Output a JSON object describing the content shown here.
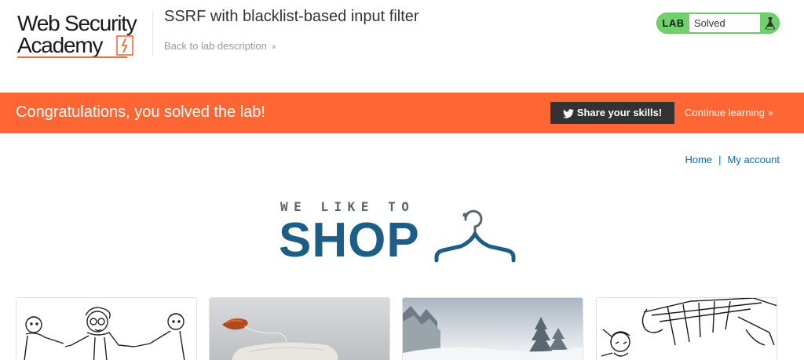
{
  "header": {
    "logo_line1": "Web Security",
    "logo_line2": "Academy",
    "lab_title": "SSRF with blacklist-based input filter",
    "back_link": "Back to lab description",
    "lab_badge": "LAB",
    "status": "Solved"
  },
  "banner": {
    "message": "Congratulations, you solved the lab!",
    "share_label": "Share your skills!",
    "continue_label": "Continue learning"
  },
  "nav": {
    "home": "Home",
    "separator": "|",
    "my_account": "My account"
  },
  "hero": {
    "tagline": "WE LIKE TO",
    "headline": "SHOP"
  },
  "products": [
    {
      "image": "cartoon-people-pulling-illustration"
    },
    {
      "image": "tea-bag-photo"
    },
    {
      "image": "snowy-landscape-photo"
    },
    {
      "image": "sketch-illustration"
    }
  ],
  "colors": {
    "brand_orange": "#ff6633",
    "solved_green": "#70d16d",
    "link_blue": "#0071bc",
    "shop_blue": "#1d5e86",
    "share_dark": "#333333"
  }
}
